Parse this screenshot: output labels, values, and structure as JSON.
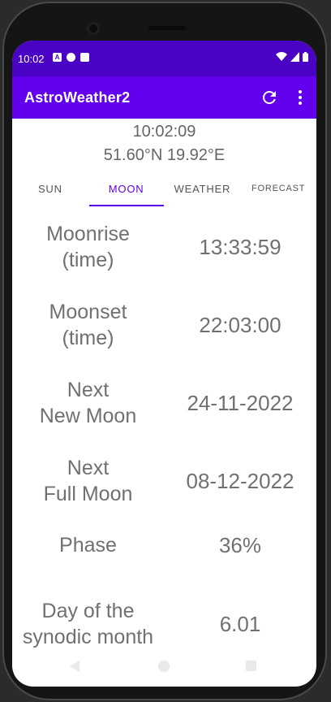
{
  "status_bar": {
    "time": "10:02",
    "left_icons": [
      "a-icon",
      "data-saver-icon",
      "sd-card-icon"
    ],
    "right_icons": [
      "wifi-icon",
      "signal-icon",
      "battery-icon"
    ]
  },
  "app_bar": {
    "title": "AstroWeather2",
    "actions": [
      "refresh-icon",
      "more-vert-icon"
    ]
  },
  "header": {
    "time": "10:02:09",
    "coordinates": "51.60°N 19.92°E"
  },
  "tabs": [
    {
      "label": "SUN",
      "active": false
    },
    {
      "label": "MOON",
      "active": true
    },
    {
      "label": "WEATHER",
      "active": false
    },
    {
      "label": "FORECAST",
      "active": false
    }
  ],
  "moon": {
    "rows": [
      {
        "label": "Moonrise\n(time)",
        "value": "13:33:59"
      },
      {
        "label": "Moonset\n(time)",
        "value": "22:03:00"
      },
      {
        "label": "Next\nNew Moon",
        "value": "24-11-2022"
      },
      {
        "label": "Next\nFull Moon",
        "value": "08-12-2022"
      },
      {
        "label": "Phase",
        "value": "36%"
      },
      {
        "label": "Day of the\nsynodic month",
        "value": "6.01"
      }
    ]
  },
  "nav_bar": {
    "buttons": [
      "back-icon",
      "home-icon",
      "recents-icon"
    ]
  },
  "colors": {
    "status_bar": "#4a03c4",
    "app_bar": "#6200ee",
    "accent": "#6200ee",
    "text": "#707070"
  }
}
